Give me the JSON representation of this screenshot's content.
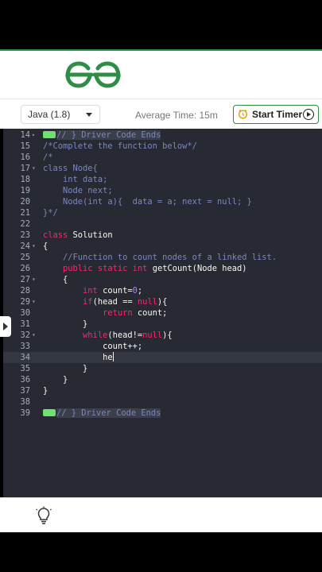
{
  "toolbar": {
    "language": "Java (1.8)",
    "avg_time": "Average Time: 15m",
    "timer_label": "Start Timer"
  },
  "code_lines": [
    {
      "n": "14",
      "fold": "▸",
      "text": "// } Driver Code Ends"
    },
    {
      "n": "15",
      "fold": "",
      "text": "/*Complete the function below*/"
    },
    {
      "n": "16",
      "fold": "",
      "text": "/*"
    },
    {
      "n": "17",
      "fold": "▾",
      "text": "class Node{"
    },
    {
      "n": "18",
      "fold": "",
      "text": "    int data;"
    },
    {
      "n": "19",
      "fold": "",
      "text": "    Node next;"
    },
    {
      "n": "20",
      "fold": "",
      "text": "    Node(int a){  data = a; next = null; }"
    },
    {
      "n": "21",
      "fold": "",
      "text": "}*/"
    },
    {
      "n": "22",
      "fold": "",
      "text": ""
    },
    {
      "n": "23",
      "fold": "",
      "text": "class Solution"
    },
    {
      "n": "24",
      "fold": "▾",
      "text": "{"
    },
    {
      "n": "25",
      "fold": "",
      "text": "    //Function to count nodes of a linked list."
    },
    {
      "n": "26",
      "fold": "",
      "text": "    public static int getCount(Node head)"
    },
    {
      "n": "27",
      "fold": "▾",
      "text": "    {"
    },
    {
      "n": "28",
      "fold": "",
      "text": "        int count=0;"
    },
    {
      "n": "29",
      "fold": "▾",
      "text": "        if(head == null){"
    },
    {
      "n": "30",
      "fold": "",
      "text": "            return count;"
    },
    {
      "n": "31",
      "fold": "",
      "text": "        }"
    },
    {
      "n": "32",
      "fold": "▾",
      "text": "        while(head!=null){"
    },
    {
      "n": "33",
      "fold": "",
      "text": "            count++;"
    },
    {
      "n": "34",
      "fold": "",
      "text": "            he"
    },
    {
      "n": "35",
      "fold": "",
      "text": "        }"
    },
    {
      "n": "36",
      "fold": "",
      "text": "    }"
    },
    {
      "n": "37",
      "fold": "",
      "text": "}"
    },
    {
      "n": "38",
      "fold": "",
      "text": ""
    },
    {
      "n": "39",
      "fold": "",
      "text": "// } Driver Code Ends"
    }
  ],
  "colors": {
    "brand_green": "#2f8d46",
    "editor_bg": "#272a33",
    "comment": "#7d86c2",
    "keyword": "#f92672",
    "number": "#ae81ff"
  }
}
